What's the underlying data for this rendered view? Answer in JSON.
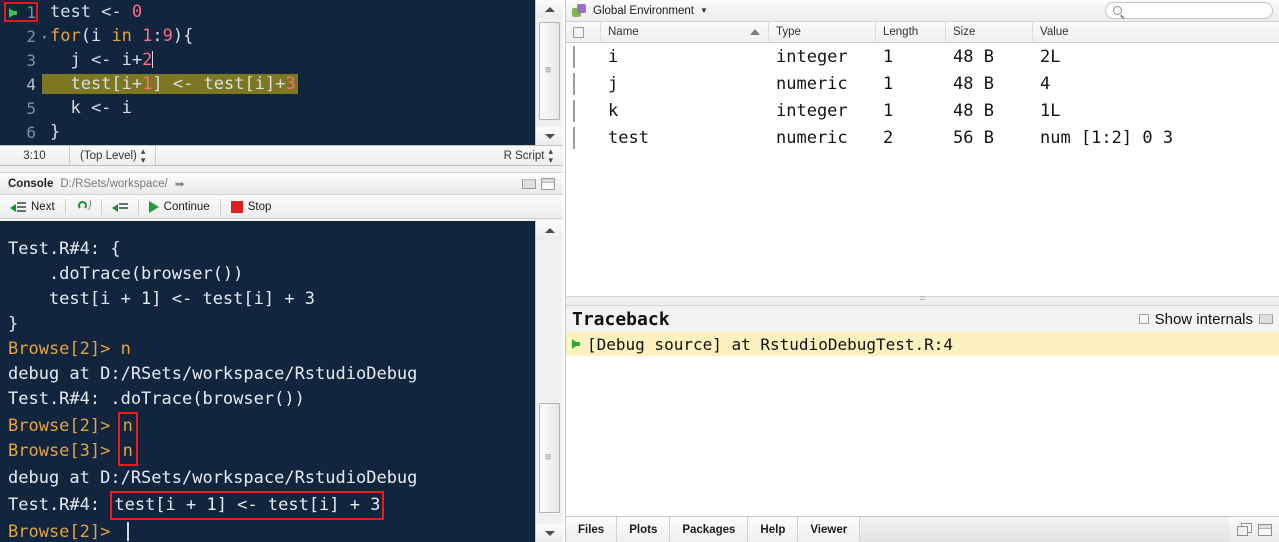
{
  "editor": {
    "lines": [
      {
        "num": "1",
        "fold": false,
        "tokens": [
          {
            "t": "test <- ",
            "c": "pl"
          },
          {
            "t": "0",
            "c": "num"
          }
        ]
      },
      {
        "num": "2",
        "fold": true,
        "tokens": [
          {
            "t": "for",
            "c": "kw"
          },
          {
            "t": "(i ",
            "c": "pl"
          },
          {
            "t": "in",
            "c": "kw"
          },
          {
            "t": " ",
            "c": "pl"
          },
          {
            "t": "1",
            "c": "num"
          },
          {
            "t": ":",
            "c": "pl"
          },
          {
            "t": "9",
            "c": "num"
          },
          {
            "t": "){",
            "c": "pl"
          }
        ]
      },
      {
        "num": "3",
        "fold": false,
        "tokens": [
          {
            "t": "  j <- i+",
            "c": "pl"
          },
          {
            "t": "2",
            "c": "num"
          }
        ]
      },
      {
        "num": "4",
        "fold": false,
        "highlight": true,
        "breakpoint": true,
        "tokens": [
          {
            "t": "  test[i+",
            "c": "pl"
          },
          {
            "t": "1",
            "c": "num"
          },
          {
            "t": "] <- test[i]+",
            "c": "pl"
          },
          {
            "t": "3",
            "c": "num"
          }
        ]
      },
      {
        "num": "5",
        "fold": false,
        "tokens": [
          {
            "t": "  k <- i",
            "c": "pl"
          }
        ]
      },
      {
        "num": "6",
        "fold": false,
        "tokens": [
          {
            "t": "}",
            "c": "pl"
          }
        ]
      }
    ]
  },
  "editor_status": {
    "cursor_position": "3:10",
    "scope": "(Top Level)",
    "file_type": "R Script"
  },
  "console": {
    "title": "Console",
    "path": "D:/RSets/workspace/",
    "toolbar": {
      "next_label": "Next",
      "continue_label": "Continue",
      "stop_label": "Stop"
    },
    "lines": [
      {
        "segments": [
          {
            "t": "debug at D:/RSets/workspace/RstudioDebug",
            "c": "clip"
          }
        ]
      },
      {
        "segments": [
          {
            "t": "Test.R#4: {",
            "c": "out"
          }
        ]
      },
      {
        "segments": [
          {
            "t": "    .doTrace(browser())",
            "c": "out"
          }
        ]
      },
      {
        "segments": [
          {
            "t": "    test[i + 1] <- test[i] + 3",
            "c": "out"
          }
        ]
      },
      {
        "segments": [
          {
            "t": "}",
            "c": "out"
          }
        ]
      },
      {
        "segments": [
          {
            "t": "Browse[2]> ",
            "c": "prompt"
          },
          {
            "t": "n",
            "c": "prompt"
          }
        ]
      },
      {
        "segments": [
          {
            "t": "debug at D:/RSets/workspace/RstudioDebug",
            "c": "out"
          }
        ]
      },
      {
        "segments": [
          {
            "t": "Test.R#4: .doTrace(browser())",
            "c": "out"
          }
        ]
      },
      {
        "segments": [
          {
            "t": "Browse[2]> ",
            "c": "prompt"
          },
          {
            "t": "n",
            "c": "prompt",
            "box": "top"
          }
        ]
      },
      {
        "segments": [
          {
            "t": "Browse[3]> ",
            "c": "prompt"
          },
          {
            "t": "n",
            "c": "prompt",
            "box": "bottom"
          }
        ]
      },
      {
        "segments": [
          {
            "t": "debug at D:/RSets/workspace/RstudioDebug",
            "c": "out"
          }
        ]
      },
      {
        "segments": [
          {
            "t": "Test.R#4: ",
            "c": "out"
          },
          {
            "t": "test[i + 1] <- test[i] + 3",
            "c": "out",
            "box": "full"
          }
        ]
      },
      {
        "segments": [
          {
            "t": "Browse[2]> ",
            "c": "prompt"
          },
          {
            "t": "",
            "c": "caret"
          }
        ]
      }
    ]
  },
  "environment": {
    "scope_label": "Global Environment",
    "search_placeholder": "",
    "columns": [
      "Name",
      "Type",
      "Length",
      "Size",
      "Value"
    ],
    "sorted_by": "Name",
    "rows": [
      {
        "name": "i",
        "type": "integer",
        "length": "1",
        "size": "48 B",
        "value": "2L"
      },
      {
        "name": "j",
        "type": "numeric",
        "length": "1",
        "size": "48 B",
        "value": "4"
      },
      {
        "name": "k",
        "type": "integer",
        "length": "1",
        "size": "48 B",
        "value": "1L"
      },
      {
        "name": "test",
        "type": "numeric",
        "length": "2",
        "size": "56 B",
        "value": "num [1:2] 0 3"
      }
    ]
  },
  "traceback": {
    "title": "Traceback",
    "show_internals_label": "Show internals",
    "items": [
      {
        "text": "[Debug source] at RstudioDebugTest.R:4",
        "active": true
      }
    ]
  },
  "bottom_tabs": {
    "tabs": [
      "Files",
      "Plots",
      "Packages",
      "Help",
      "Viewer"
    ]
  },
  "colors": {
    "editor_bg": "#11253f",
    "highlight": "#7d7722",
    "prompt": "#e8a33d",
    "annotation_red": "#ee1c1c",
    "traceback_highlight": "#fdf2bf",
    "debug_green": "#2aa83f"
  }
}
